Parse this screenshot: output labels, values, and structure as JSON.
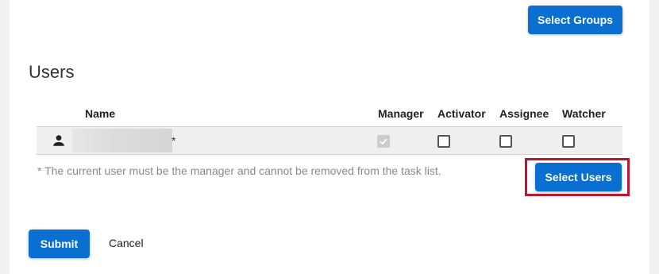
{
  "header": {
    "select_groups_label": "Select Groups"
  },
  "users_section": {
    "title": "Users",
    "columns": {
      "name": "Name",
      "manager": "Manager",
      "activator": "Activator",
      "assignee": "Assignee",
      "watcher": "Watcher"
    },
    "rows": [
      {
        "icon": "person-icon",
        "name": "",
        "name_redacted": true,
        "marker": "*",
        "manager": true,
        "manager_disabled": true,
        "activator": false,
        "assignee": false,
        "watcher": false
      }
    ],
    "footnote": "* The current user must be the manager and cannot be removed from the task list.",
    "select_users_label": "Select Users"
  },
  "footer": {
    "submit_label": "Submit",
    "cancel_label": "Cancel"
  },
  "colors": {
    "primary": "#0a6fd1",
    "highlight": "#c0152f",
    "row_background": "#efefef"
  }
}
